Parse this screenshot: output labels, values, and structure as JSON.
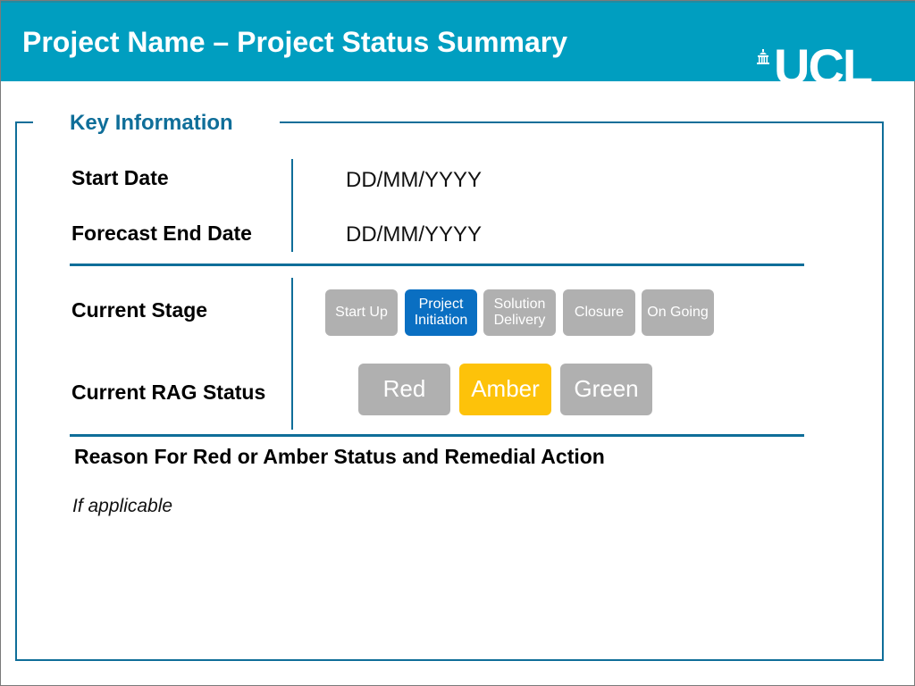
{
  "header": {
    "title": "Project Name – Project Status Summary",
    "logo_text": "UCL",
    "logo_icon": "portico-building-icon",
    "background_color": "#009ec0"
  },
  "key_information": {
    "section_title": "Key Information",
    "start_date_label": "Start Date",
    "start_date_value": "DD/MM/YYYY",
    "forecast_end_date_label": "Forecast End Date",
    "forecast_end_date_value": "DD/MM/YYYY",
    "current_stage_label": "Current Stage",
    "stages": [
      {
        "label": "Start Up",
        "active": false
      },
      {
        "label": "Project Initiation",
        "active": true
      },
      {
        "label": "Solution Delivery",
        "active": false
      },
      {
        "label": "Closure",
        "active": false
      },
      {
        "label": "On Going",
        "active": false
      }
    ],
    "rag_label": "Current RAG Status",
    "rag_options": [
      {
        "label": "Red",
        "active": false
      },
      {
        "label": "Amber",
        "active": true
      },
      {
        "label": "Green",
        "active": false
      }
    ],
    "active_stage_color": "#0a6fc2",
    "active_rag_color": "#fdc20a",
    "inactive_color": "#b0b0b0"
  },
  "reason": {
    "title": "Reason For Red or Amber Status and Remedial Action",
    "note": "If applicable"
  }
}
